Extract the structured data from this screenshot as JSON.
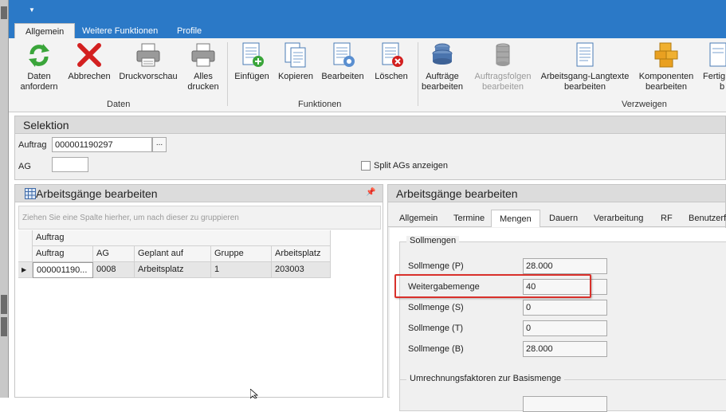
{
  "ribbon": {
    "tabs": [
      "Allgemein",
      "Weitere Funktionen",
      "Profile"
    ],
    "groups": {
      "daten": "Daten",
      "funktionen": "Funktionen",
      "verzweigen": "Verzweigen"
    },
    "buttons": {
      "daten_anfordern": [
        "Daten",
        "anfordern"
      ],
      "abbrechen": [
        "Abbrechen"
      ],
      "druckvorschau": [
        "Druckvorschau"
      ],
      "alles_drucken": [
        "Alles",
        "drucken"
      ],
      "einfuegen": [
        "Einfügen"
      ],
      "kopieren": [
        "Kopieren"
      ],
      "bearbeiten": [
        "Bearbeiten"
      ],
      "loeschen": [
        "Löschen"
      ],
      "auftraege_bearbeiten": [
        "Aufträge",
        "bearbeiten"
      ],
      "auftragsfolgen_bearbeiten": [
        "Auftragsfolgen",
        "bearbeiten"
      ],
      "arbeitsgang_langtexte": [
        "Arbeitsgang-Langtexte",
        "bearbeiten"
      ],
      "komponenten_bearbeiten": [
        "Komponenten",
        "bearbeiten"
      ],
      "fertig": [
        "Fertig",
        "b"
      ]
    }
  },
  "selektion": {
    "title": "Selektion",
    "auftrag_label": "Auftrag",
    "auftrag_value": "000001190297",
    "browse_label": "...",
    "ag_label": "AG",
    "ag_value": "",
    "split_label": "Split AGs anzeigen"
  },
  "left_panel": {
    "title": "Arbeitsgänge bearbeiten",
    "group_hint": "Ziehen Sie eine Spalte hierher, um nach dieser zu gruppieren",
    "band_header": "Auftrag",
    "columns": [
      "Auftrag",
      "AG",
      "Geplant auf",
      "Gruppe",
      "Arbeitsplatz"
    ],
    "rows": [
      [
        "000001190...",
        "0008",
        "Arbeitsplatz",
        "1",
        "203003"
      ]
    ]
  },
  "right_panel": {
    "title": "Arbeitsgänge bearbeiten",
    "tabs": [
      "Allgemein",
      "Termine",
      "Mengen",
      "Dauern",
      "Verarbeitung",
      "RF",
      "Benutzerf"
    ],
    "active_tab": "Mengen",
    "sollmengen_title": "Sollmengen",
    "fields": [
      {
        "label": "Sollmenge (P)",
        "value": "28.000"
      },
      {
        "label": "Weitergabemenge",
        "value": "40"
      },
      {
        "label": "Sollmenge (S)",
        "value": "0"
      },
      {
        "label": "Sollmenge (T)",
        "value": "0"
      },
      {
        "label": "Sollmenge (B)",
        "value": "28.000"
      }
    ],
    "umrechnung_title": "Umrechnungsfaktoren zur Basismenge",
    "highlight_color": "#d9312b"
  }
}
